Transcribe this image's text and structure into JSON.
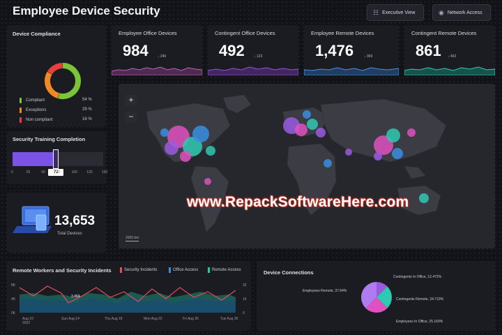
{
  "header": {
    "title": "Employee Device Security",
    "buttons": [
      {
        "label": "Executive View",
        "icon": "hierarchy-icon"
      },
      {
        "label": "Network Access",
        "icon": "network-icon"
      }
    ]
  },
  "compliance": {
    "title": "Device Compliance",
    "legend": [
      {
        "label": "Compliant",
        "pct": "54 %",
        "color": "#7cc437"
      },
      {
        "label": "Exceptions",
        "pct": "29 %",
        "color": "#f08a24"
      },
      {
        "label": "Non compliant",
        "pct": "16 %",
        "color": "#e8403a"
      }
    ],
    "donut_values": [
      54,
      29,
      16
    ]
  },
  "training": {
    "title": "Security Training Completion",
    "value_label": "72",
    "value": 72,
    "ticks": [
      "0",
      "25",
      "50",
      "75",
      "100",
      "125",
      "150"
    ]
  },
  "total": {
    "value": "13,653",
    "label": "Total Devices"
  },
  "kpis": [
    {
      "label": "Employee Office Devices",
      "value": "984",
      "delta": "↓ 246",
      "color": "#b04aa8"
    },
    {
      "label": "Contingent Office Devices",
      "value": "492",
      "delta": "↓ 123",
      "color": "#8a3ad0"
    },
    {
      "label": "Employee Remote Devices",
      "value": "1,476",
      "delta": "↓ 369",
      "color": "#2f7fd8"
    },
    {
      "label": "Contingent Remote Devices",
      "value": "861",
      "delta": "↓ 492",
      "color": "#18b89a"
    }
  ],
  "map": {
    "zoom_in": "+",
    "zoom_out": "−",
    "scale": "2000 km"
  },
  "watermark": "www.RepackSoftwareHere.com",
  "remote": {
    "title": "Remote Workers and Security Incidents",
    "legend": [
      {
        "label": "Security Incidents",
        "color": "#e0505a"
      },
      {
        "label": "Office Access",
        "color": "#3a8ee0"
      },
      {
        "label": "Remote Access",
        "color": "#25c8a8"
      }
    ],
    "y_left": [
      "8K",
      "4K",
      "0K"
    ],
    "y_right": [
      "32",
      "16",
      "0"
    ],
    "x_labels": [
      "Aug 10 2022",
      "Sun Aug 14",
      "Thu Aug 18",
      "Mon Aug 22",
      "Fri Aug 26",
      "Tue Aug 30"
    ],
    "annotation": "3,464"
  },
  "connections": {
    "title": "Device Connections",
    "slices": [
      {
        "label": "Contingents In Office, 12.472%",
        "value": 12.472,
        "color": "#9a5ae0"
      },
      {
        "label": "Contingents Remote, 24.719%",
        "value": 24.719,
        "color": "#2fc8b0"
      },
      {
        "label": "Employees In Office, 25.169%",
        "value": 25.169,
        "color": "#e050c0"
      },
      {
        "label": "Employees Remote, 37.64%",
        "value": 37.64,
        "color": "#b07af0"
      }
    ]
  }
}
